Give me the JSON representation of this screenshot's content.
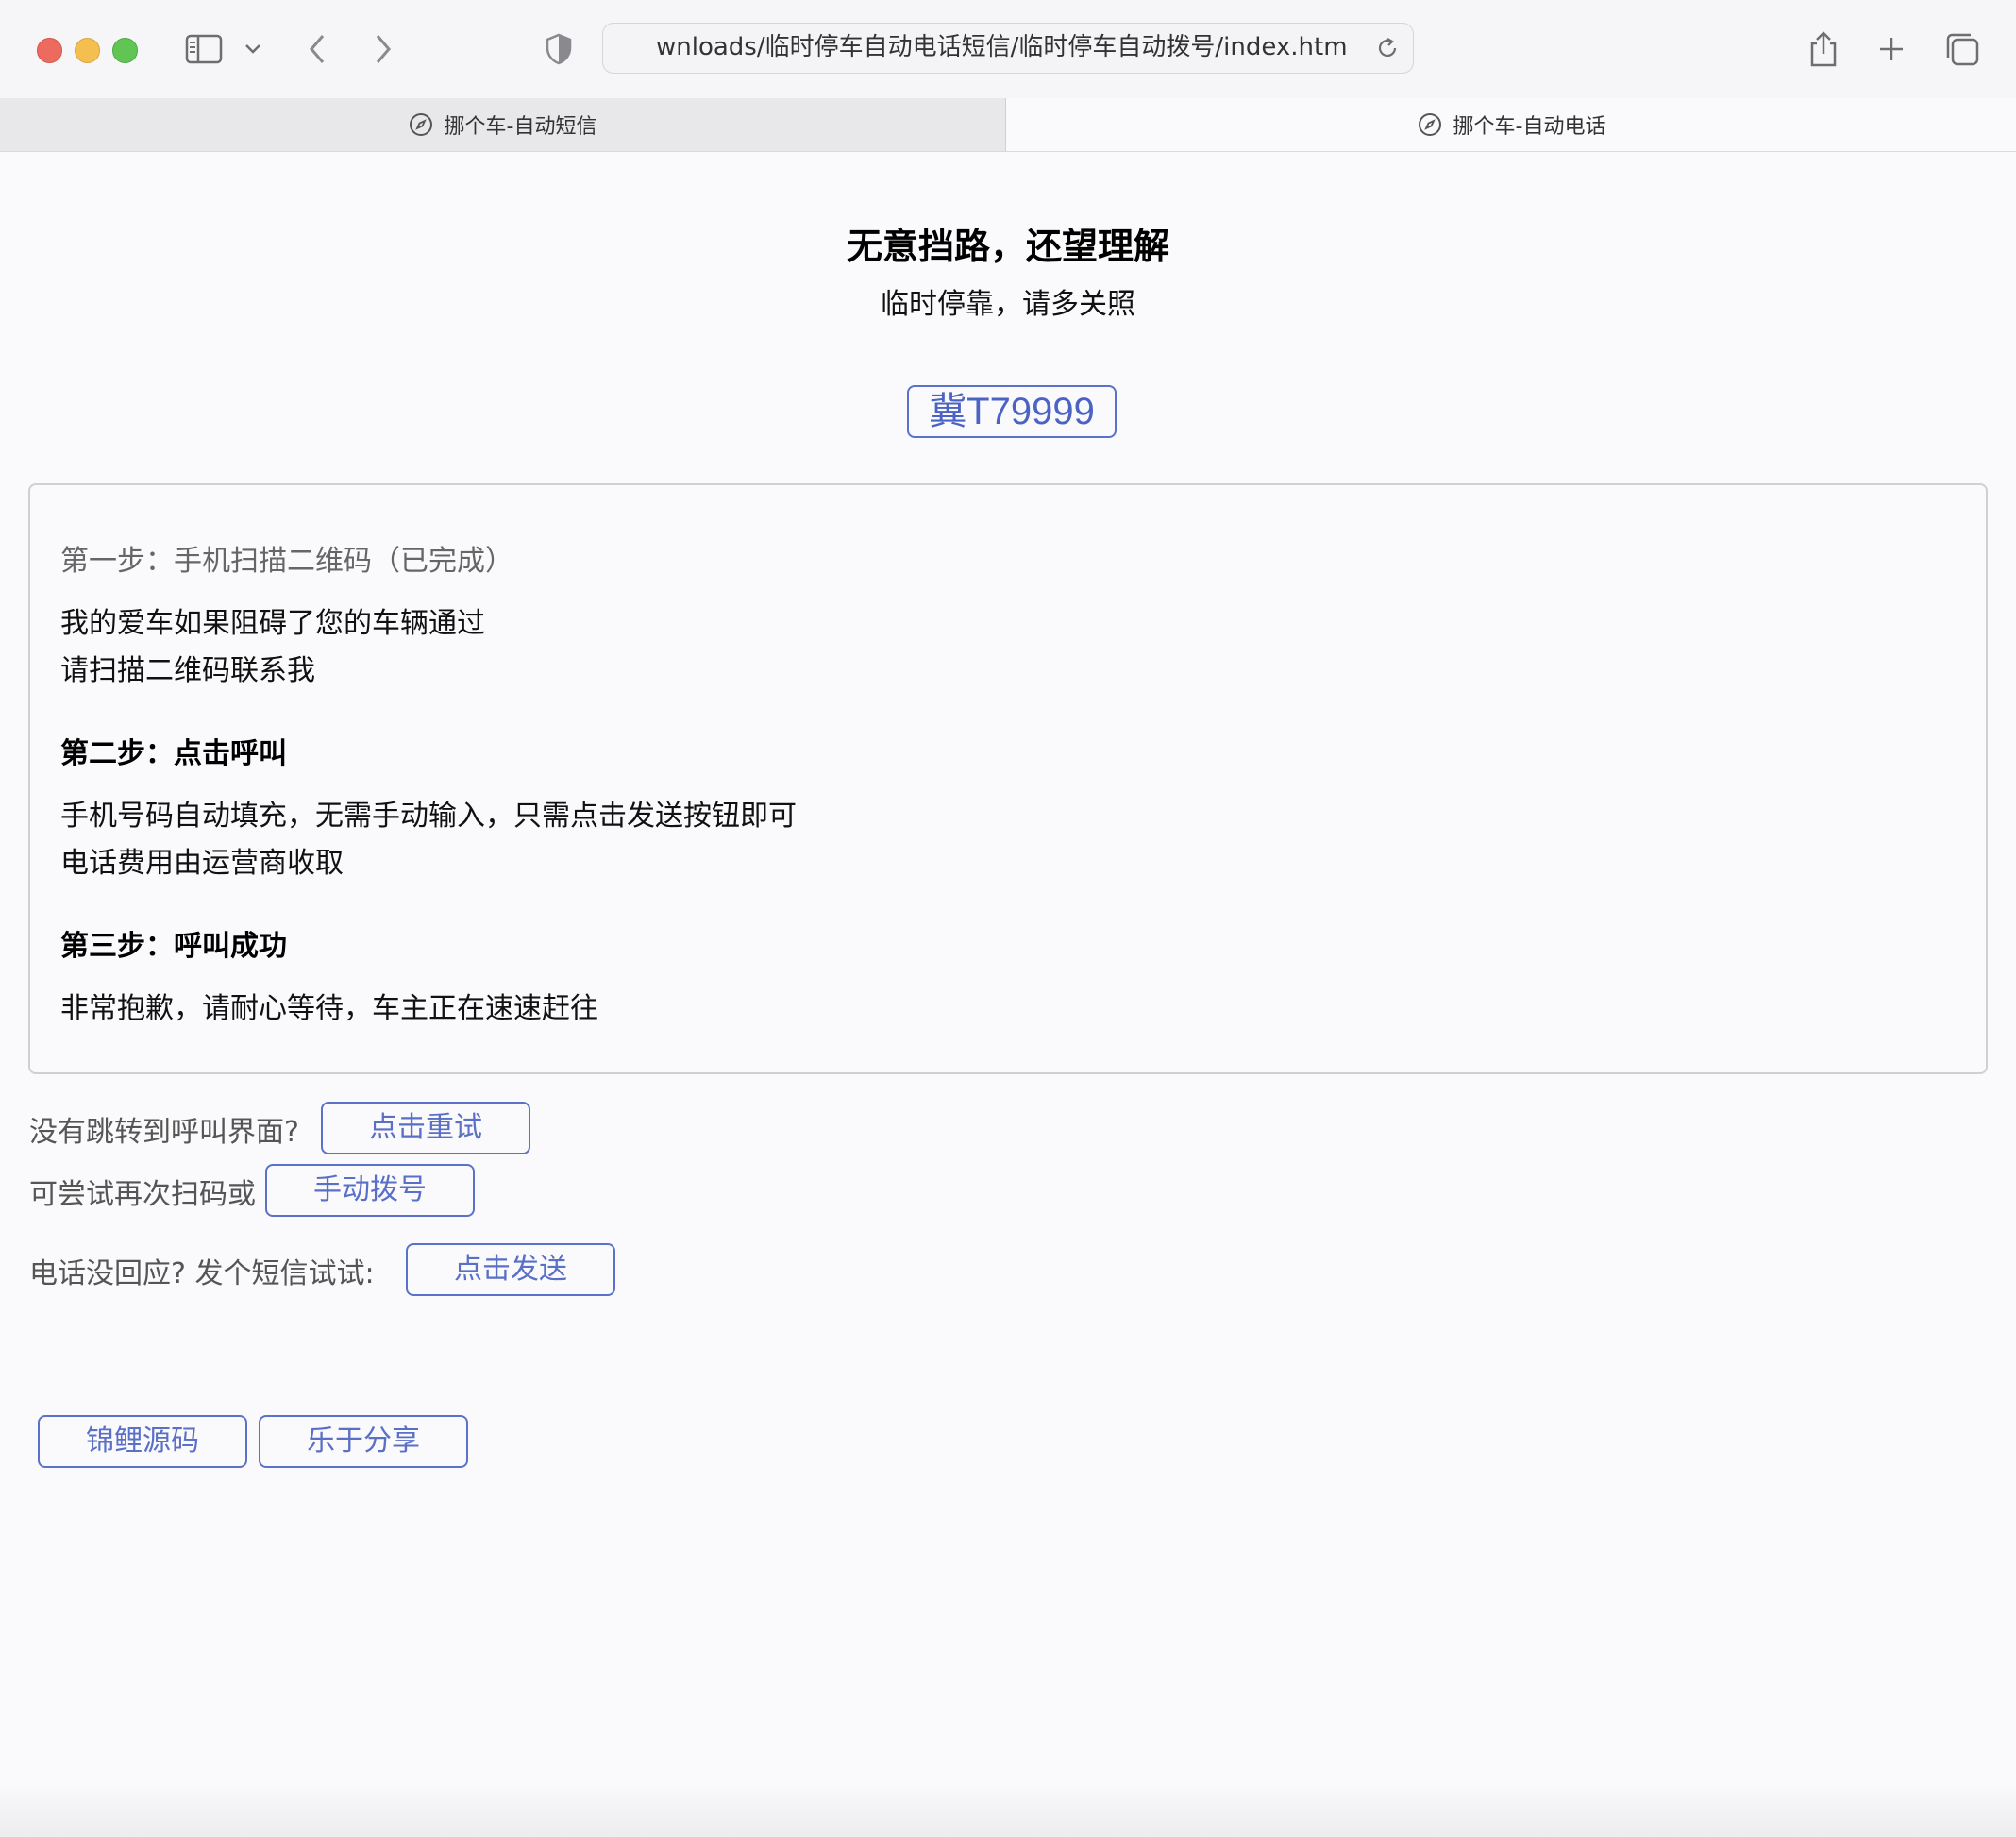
{
  "browser": {
    "address": "wnloads/临时停车自动电话短信/临时停车自动拨号/index.html",
    "tabs": [
      {
        "label": "挪个车-自动短信",
        "active": false
      },
      {
        "label": "挪个车-自动电话",
        "active": true
      }
    ]
  },
  "page": {
    "title": "无意挡路，还望理解",
    "subtitle": "临时停靠，请多关照",
    "plate": "冀T79999"
  },
  "steps": {
    "step1_title": "第一步：手机扫描二维码（已完成）",
    "step1_line1": "我的爱车如果阻碍了您的车辆通过",
    "step1_line2": "请扫描二维码联系我",
    "step2_title": "第二步：点击呼叫",
    "step2_line1": "手机号码自动填充，无需手动输入，只需点击发送按钮即可",
    "step2_line2": "电话费用由运营商收取",
    "step3_title": "第三步：呼叫成功",
    "step3_line1": "非常抱歉，请耐心等待，车主正在速速赶往"
  },
  "actions": {
    "retry_label": "没有跳转到呼叫界面?",
    "retry_button": "点击重试",
    "manual_label": "可尝试再次扫码或",
    "manual_button": "手动拨号",
    "sms_label": "电话没回应? 发个短信试试:",
    "sms_button": "点击发送"
  },
  "footer": {
    "source_button": "锦鲤源码",
    "share_button": "乐于分享"
  },
  "colors": {
    "accent": "#5a72c8",
    "traffic_red": "#ec6a5e",
    "traffic_yellow": "#f4bf4f",
    "traffic_green": "#61c554"
  }
}
